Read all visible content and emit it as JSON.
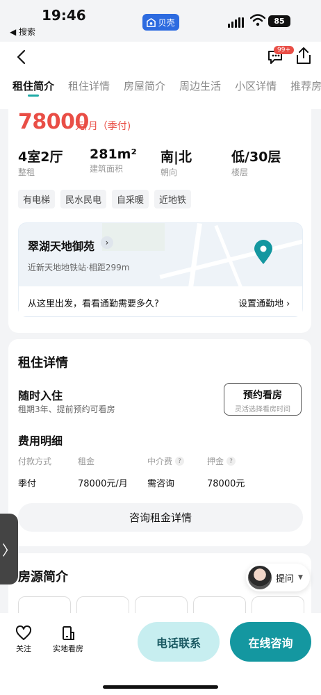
{
  "status_bar": {
    "time": "19:46",
    "back_app": "◀ 搜索",
    "app_badge": "贝壳",
    "battery": "85"
  },
  "header": {
    "chat_badge": "99+"
  },
  "tabs": [
    {
      "label": "租住简介",
      "active": true
    },
    {
      "label": "租住详情"
    },
    {
      "label": "房屋简介"
    },
    {
      "label": "周边生活"
    },
    {
      "label": "小区详情"
    },
    {
      "label": "推荐房"
    }
  ],
  "price": {
    "amount": "78000",
    "unit": "元/月（季付)"
  },
  "specs": [
    {
      "value": "4室2厅",
      "label": "整租"
    },
    {
      "value": "281m²",
      "label": "建筑面积"
    },
    {
      "value": "南|北",
      "label": "朝向"
    },
    {
      "value": "低/30层",
      "label": "楼层"
    }
  ],
  "tags": [
    "有电梯",
    "民水民电",
    "自采暖",
    "近地铁"
  ],
  "map": {
    "community": "翠湖天地御苑",
    "metro": "近新天地地铁站·相距299m",
    "commute_question": "从这里出发，看看通勤需要多久?",
    "commute_setting": "设置通勤地"
  },
  "rent_details": {
    "title": "租住详情",
    "move_in": "随时入住",
    "lease": "租期3年、提前预约可看房",
    "visit_button": "预约看房",
    "visit_sub": "灵活选择看房时间",
    "fee_title": "费用明细",
    "fee_headers": [
      "付款方式",
      "租金",
      "中介费",
      "押金"
    ],
    "fee_values": [
      "季付",
      "78000元/月",
      "需咨询",
      "78000元"
    ],
    "consult_button": "咨询租金详情"
  },
  "listing_intro": {
    "title": "房源简介",
    "ask_label": "提问"
  },
  "bottom_bar": {
    "follow": "关注",
    "onsite": "实地看房",
    "phone": "电话联系",
    "online": "在线咨询"
  },
  "colors": {
    "price": "#e94e46",
    "accent": "#1497a0",
    "phone_bg": "#c7eef0"
  }
}
